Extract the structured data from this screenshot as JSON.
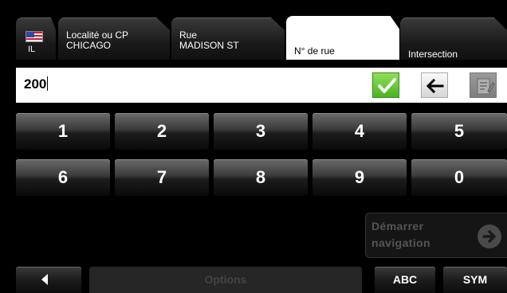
{
  "tabs": {
    "region": {
      "code": "IL",
      "flag_icon": "us-flag-icon"
    },
    "city": {
      "label": "Localité ou CP",
      "value": "CHICAGO"
    },
    "street": {
      "label": "Rue",
      "value": "MADISON ST"
    },
    "house_number": {
      "label": "N° de rue"
    },
    "intersection": {
      "label": "Intersection"
    }
  },
  "input": {
    "value": "200"
  },
  "actions": {
    "confirm_icon": "check-icon",
    "backspace_icon": "back-arrow-icon",
    "notes_icon": "notepad-icon"
  },
  "keypad": {
    "row1": [
      "1",
      "2",
      "3",
      "4",
      "5"
    ],
    "row2": [
      "6",
      "7",
      "8",
      "9",
      "0"
    ]
  },
  "start_navigation": {
    "line1": "Démarrer",
    "line2": "navigation",
    "icon": "arrow-right-icon"
  },
  "bottom": {
    "back_icon": "triangle-left-icon",
    "options": "Options",
    "abc": "ABC",
    "sym": "SYM"
  },
  "colors": {
    "confirm_green": "#5cc42b",
    "active_tab": "#ffffff",
    "background": "#000000"
  }
}
